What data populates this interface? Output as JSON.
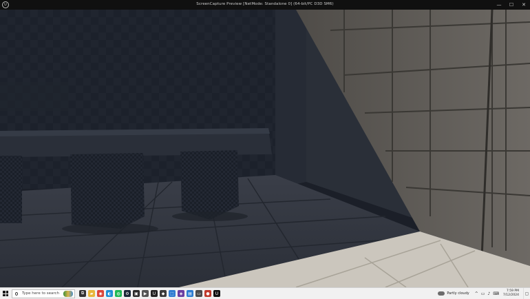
{
  "window": {
    "title": "ScreenCapture Preview [NetMode: Standalone 0]  (64-bit/PC D3D SM6)",
    "icon_label": "U",
    "controls": {
      "minimize": "—",
      "maximize": "☐",
      "close": "✕"
    }
  },
  "viewport": {
    "description_icon": "3d-scene"
  },
  "taskbar": {
    "search_placeholder": "Type here to search",
    "apps": [
      {
        "name": "task-view-icon",
        "glyph": "⧉",
        "color": "#333333"
      },
      {
        "name": "file-explorer-icon",
        "glyph": "▰",
        "color": "#e8b73a"
      },
      {
        "name": "chrome-icon",
        "glyph": "◉",
        "color": "#db4437"
      },
      {
        "name": "edge-icon",
        "glyph": "◐",
        "color": "#1f8fd6"
      },
      {
        "name": "spotify-icon",
        "glyph": "◍",
        "color": "#1db954"
      },
      {
        "name": "steam-icon",
        "glyph": "⚙",
        "color": "#1b2838"
      },
      {
        "name": "epic-games-icon",
        "glyph": "▣",
        "color": "#2a2a2a"
      },
      {
        "name": "media-player-icon",
        "glyph": "▶",
        "color": "#555555"
      },
      {
        "name": "unreal-icon",
        "glyph": "U",
        "color": "#222222"
      },
      {
        "name": "game-launcher-icon",
        "glyph": "◆",
        "color": "#3a3a3a"
      },
      {
        "name": "store-icon",
        "glyph": "⬚",
        "color": "#2f7dd1"
      },
      {
        "name": "visual-studio-icon",
        "glyph": "◈",
        "color": "#6a3ea1"
      },
      {
        "name": "photos-icon",
        "glyph": "▤",
        "color": "#2d7dd2"
      },
      {
        "name": "notepad-icon",
        "glyph": "▭",
        "color": "#4a4a4a"
      },
      {
        "name": "recording-icon",
        "glyph": "●",
        "color": "#c0392b"
      },
      {
        "name": "unreal-editor-icon",
        "glyph": "U",
        "color": "#111111"
      }
    ],
    "weather": "Partly cloudy",
    "tray_icons": [
      "^",
      "▭",
      "♪",
      "⌨"
    ],
    "clock": {
      "time": "7:59 PM",
      "date": "7/12/2024"
    },
    "notification_icon": "▢"
  }
}
